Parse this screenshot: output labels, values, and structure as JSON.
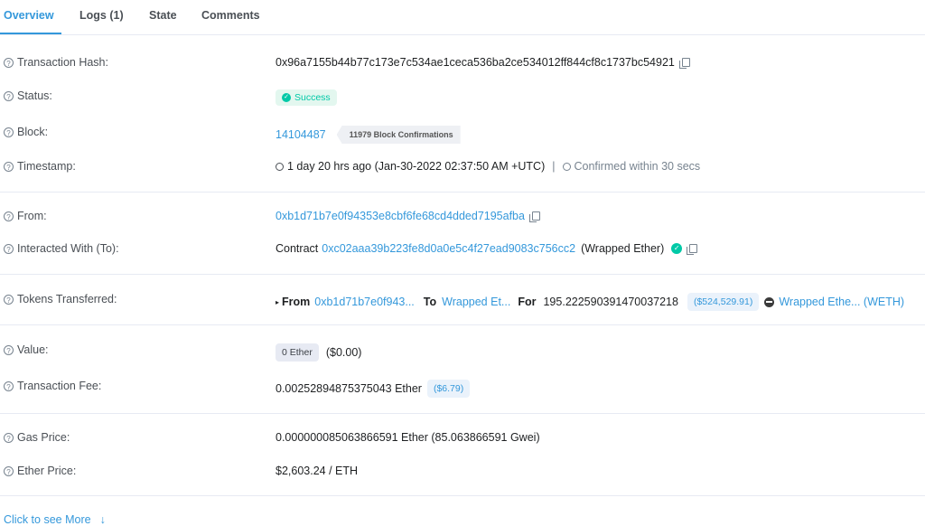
{
  "tabs": [
    {
      "label": "Overview"
    },
    {
      "label": "Logs (1)"
    },
    {
      "label": "State"
    },
    {
      "label": "Comments"
    }
  ],
  "tx_hash": {
    "label": "Transaction Hash:",
    "value": "0x96a7155b44b77c173e7c534ae1ceca536ba2ce534012ff844cf8c1737bc54921"
  },
  "status": {
    "label": "Status:",
    "value": "Success"
  },
  "block": {
    "label": "Block:",
    "value": "14104487",
    "confirmations": "11979 Block Confirmations"
  },
  "timestamp": {
    "label": "Timestamp:",
    "value": "1 day 20 hrs ago (Jan-30-2022 02:37:50 AM +UTC)",
    "separator": "|",
    "confirmed": "Confirmed within 30 secs"
  },
  "from": {
    "label": "From:",
    "value": "0xb1d71b7e0f94353e8cbf6fe68cd4dded7195afba"
  },
  "to": {
    "label": "Interacted With (To):",
    "prefix": "Contract",
    "address": "0xc02aaa39b223fe8d0a0e5c4f27ead9083c756cc2",
    "name": "(Wrapped Ether)"
  },
  "tokens": {
    "label": "Tokens Transferred:",
    "from_label": "From",
    "from_value": "0xb1d71b7e0f943...",
    "to_label": "To",
    "to_value": "Wrapped Et...",
    "for_label": "For",
    "amount": "195.222590391470037218",
    "usd": "($524,529.91)",
    "token": "Wrapped Ethe... (WETH)"
  },
  "value": {
    "label": "Value:",
    "amount": "0 Ether",
    "usd": "($0.00)"
  },
  "fee": {
    "label": "Transaction Fee:",
    "amount": "0.00252894875375043 Ether",
    "usd": "($6.79)"
  },
  "gas": {
    "label": "Gas Price:",
    "value": "0.000000085063866591 Ether (85.063866591 Gwei)"
  },
  "ether_price": {
    "label": "Ether Price:",
    "value": "$2,603.24 / ETH"
  },
  "more": {
    "label": "Click to see More"
  },
  "colors": {
    "accent": "#3498db",
    "success": "#00c9a7",
    "text": "#1e2022",
    "muted": "#77838f"
  }
}
